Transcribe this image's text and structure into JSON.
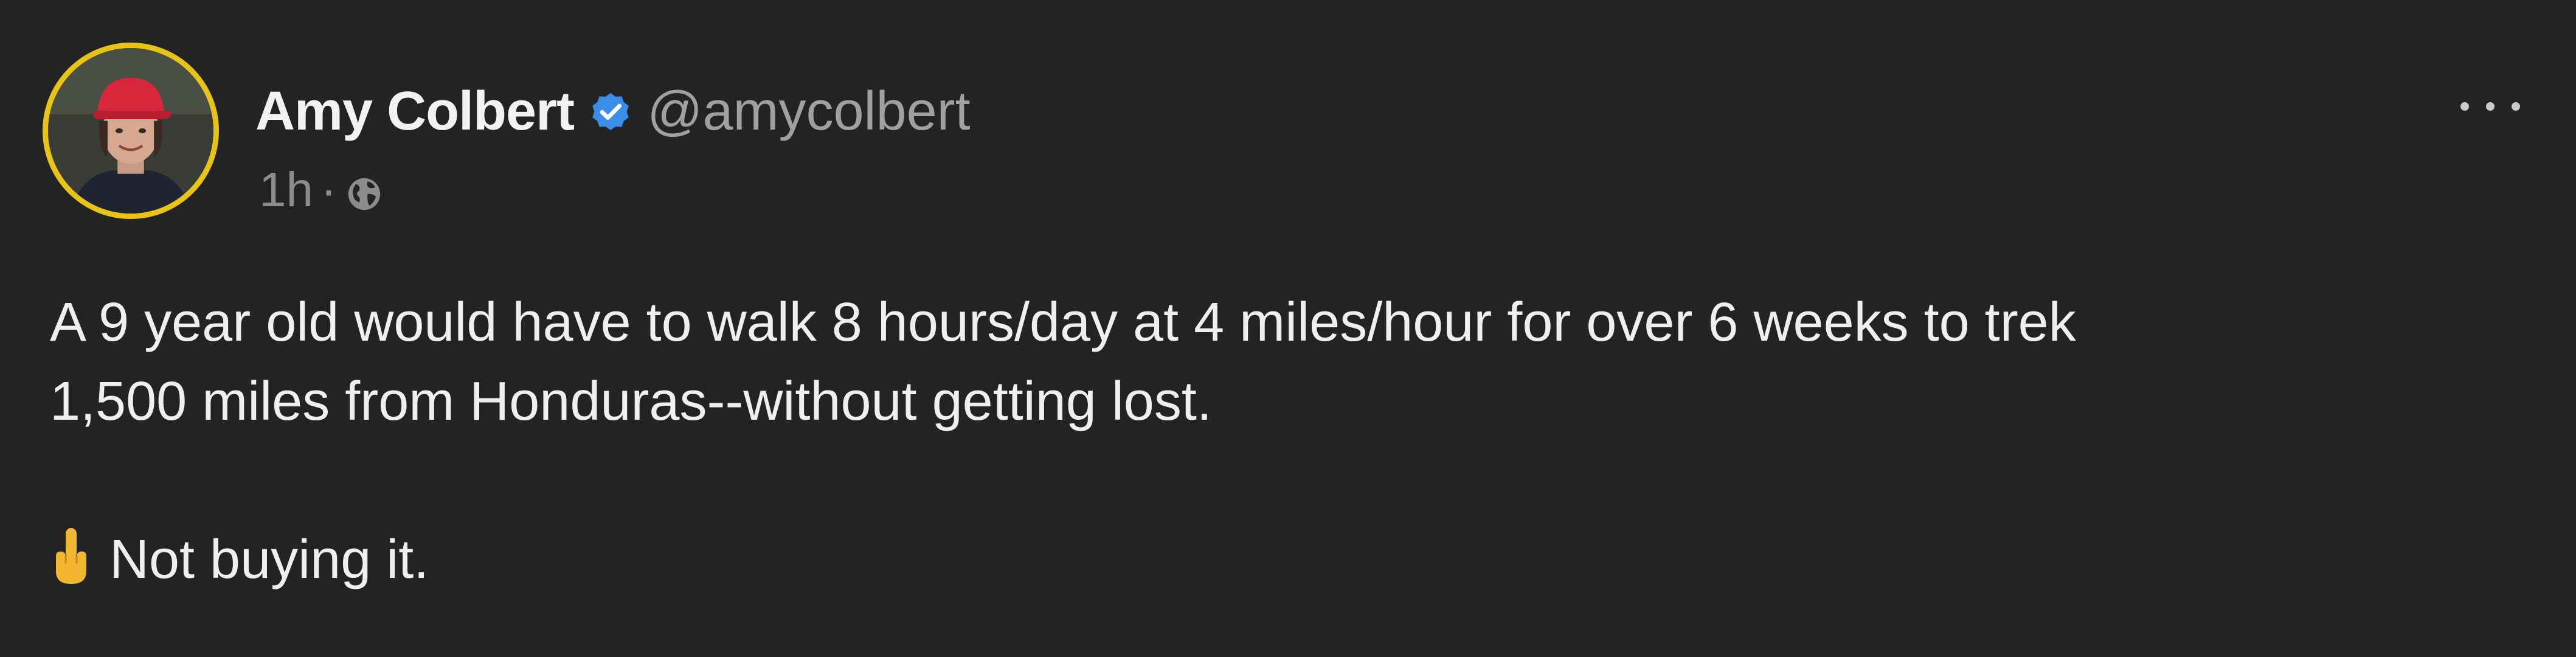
{
  "post": {
    "author": {
      "name": "Amy Colbert",
      "handle": "@amycolbert",
      "verified": true,
      "avatar_ring_color": "#e8c417"
    },
    "meta": {
      "time": "1h",
      "separator": "·",
      "visibility_icon": "globe-icon"
    },
    "more_icon": "more-dots-icon",
    "text": {
      "line1": "A 9 year old would have to walk 8 hours/day at 4 miles/hour for over 6 weeks to trek",
      "line2": "1,500 miles from Honduras--without getting lost.",
      "line3_emoji": "middle-finger-emoji",
      "line3": "Not buying it."
    }
  },
  "colors": {
    "background": "#232323",
    "text": "#efefef",
    "secondary_text": "#a0a0a0",
    "verified": "#3a8de8"
  }
}
